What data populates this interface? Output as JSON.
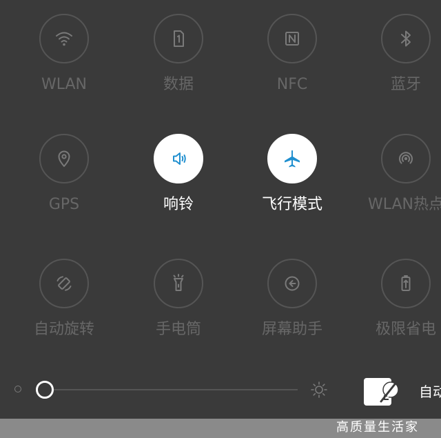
{
  "quick_settings": {
    "tiles": [
      {
        "label": "WLAN",
        "icon": "wifi-icon",
        "active": false
      },
      {
        "label": "数据",
        "icon": "sim-card-icon",
        "active": false
      },
      {
        "label": "NFC",
        "icon": "nfc-icon",
        "active": false
      },
      {
        "label": "蓝牙",
        "icon": "bluetooth-icon",
        "active": false
      },
      {
        "label": "GPS",
        "icon": "location-pin-icon",
        "active": false
      },
      {
        "label": "响铃",
        "icon": "speaker-ring-icon",
        "active": true
      },
      {
        "label": "飞行模式",
        "icon": "airplane-icon",
        "active": true
      },
      {
        "label": "WLAN热点",
        "icon": "hotspot-icon",
        "active": false
      },
      {
        "label": "自动旋转",
        "icon": "auto-rotate-icon",
        "active": false
      },
      {
        "label": "手电筒",
        "icon": "flashlight-icon",
        "active": false
      },
      {
        "label": "屏幕助手",
        "icon": "screen-assistant-icon",
        "active": false
      },
      {
        "label": "极限省电",
        "icon": "battery-saver-icon",
        "active": false
      }
    ]
  },
  "brightness": {
    "level": 0.0,
    "auto_label": "自动"
  },
  "watermark": {
    "text": "高质量生活家"
  },
  "colors": {
    "background": "#3a3a3a",
    "active_circle": "#ffffff",
    "active_icon": "#1f8fcf",
    "inactive_text": "#676767"
  }
}
